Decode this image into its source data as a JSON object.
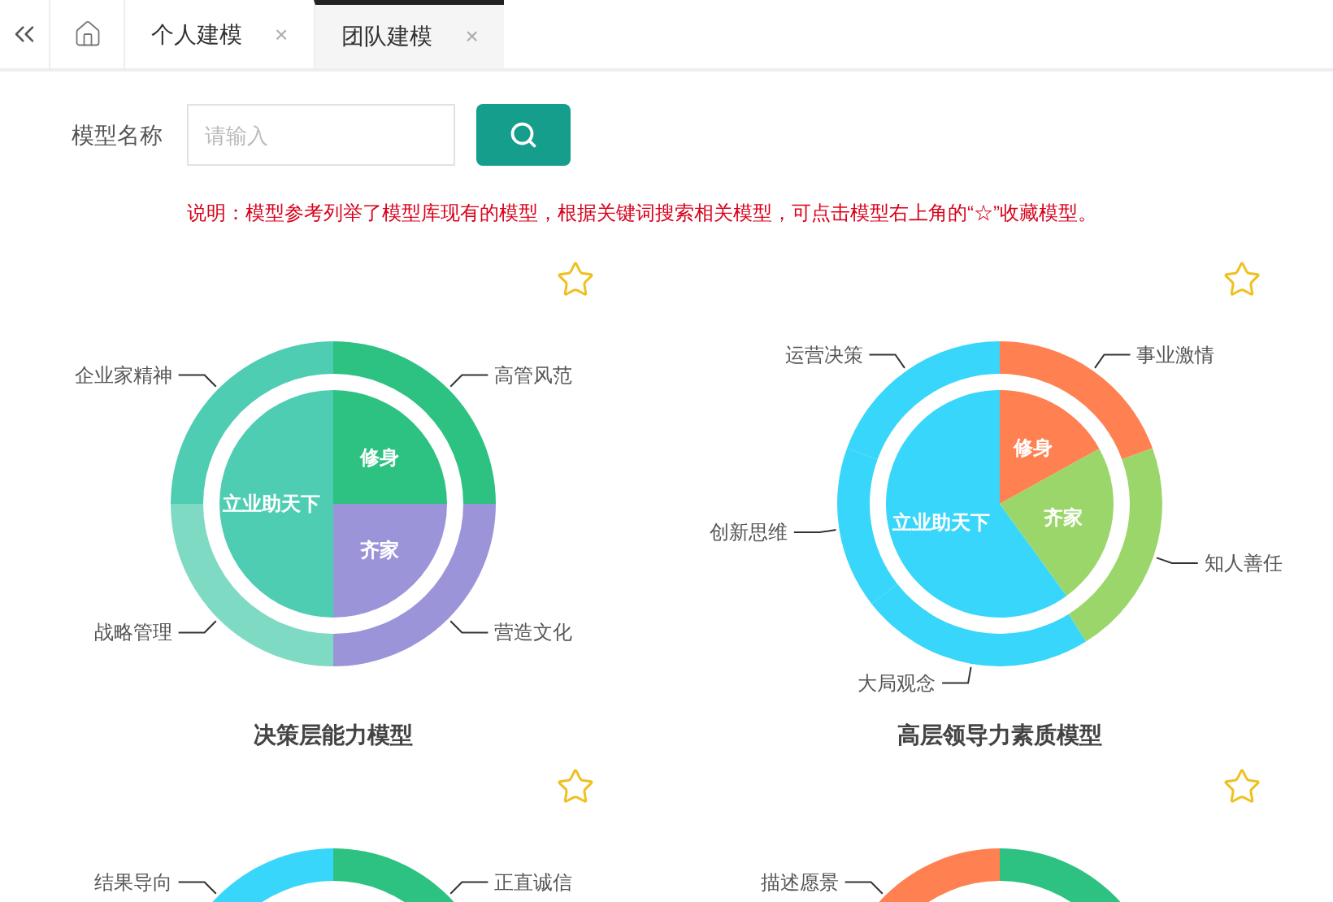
{
  "tabs": [
    {
      "kind": "home",
      "selected": false
    },
    {
      "kind": "page",
      "label": "个人建模",
      "close": "×",
      "selected": false
    },
    {
      "kind": "page",
      "label": "团队建模",
      "close": "×",
      "selected": true
    }
  ],
  "search": {
    "label": "模型名称",
    "placeholder": "请输入"
  },
  "note": "说明：模型参考列举了模型库现有的模型，根据关键词搜索相关模型，可点击模型右上角的“☆”收藏模型。",
  "models": [
    {
      "favorited": false,
      "outer": [
        {
          "label": "企业家精神",
          "color": "#4ecdb3"
        },
        {
          "label": "高管风范",
          "color": "#2dc282"
        },
        {
          "label": "战略管理",
          "color": "#7fdac4"
        },
        {
          "label": "营造文化",
          "color": "#9b94d9"
        }
      ],
      "inner": [
        {
          "label": "修身",
          "color": "#2dc282"
        },
        {
          "label": "立业助天下",
          "color": "#4ecdb3"
        },
        {
          "label": "齐家",
          "color": "#9b94d9"
        }
      ],
      "title": "决策层能力模型"
    },
    {
      "favorited": false,
      "outer": [
        {
          "label": "运营决策",
          "color": "#38d6fa"
        },
        {
          "label": "事业激情",
          "color": "#ff8050"
        },
        {
          "label": "创新思维",
          "color": "#38d6fa"
        },
        {
          "label": "知人善任",
          "color": "#9bd66a"
        },
        {
          "label": "大局观念",
          "color": "#38d6fa"
        }
      ],
      "inner": [
        {
          "label": "修身",
          "color": "#ff8050"
        },
        {
          "label": "立业助天下",
          "color": "#38d6fa"
        },
        {
          "label": "齐家",
          "color": "#9bd66a"
        }
      ],
      "title": "高层领导力素质模型"
    },
    {
      "favorited": false,
      "outer": [
        {
          "label": "结果导向",
          "color": "#38d6fa"
        },
        {
          "label": "正直诚信",
          "color": "#2dc282"
        }
      ]
    },
    {
      "favorited": false,
      "outer": [
        {
          "label": "描述愿景",
          "color": "#ff8050"
        },
        {
          "color": "#2dc282"
        }
      ]
    }
  ]
}
